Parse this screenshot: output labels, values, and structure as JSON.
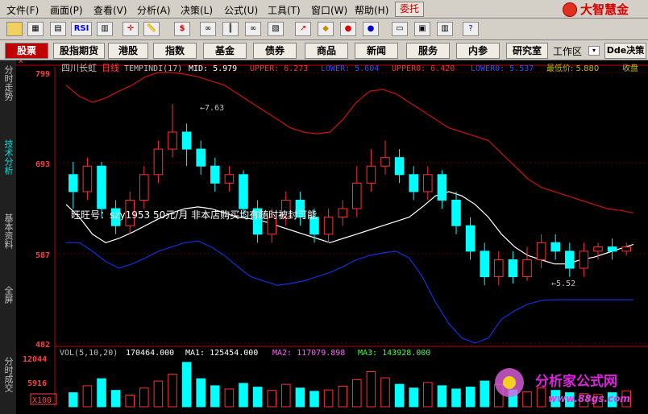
{
  "menu": [
    "文件(F)",
    "画面(P)",
    "查看(V)",
    "分析(A)",
    "决策(L)",
    "公式(U)",
    "工具(T)",
    "窗口(W)",
    "帮助(H)"
  ],
  "delegate_label": "委托",
  "brand": "大智慧金",
  "tabs": [
    "股票",
    "股指期货",
    "港股",
    "指数",
    "基金",
    "债券",
    "商品",
    "新闻",
    "服务",
    "内参",
    "研究室"
  ],
  "workspace_label": "工作区",
  "dde_label": "Dde决策",
  "side_tabs": [
    "分时走势",
    "技术分析",
    "基本资料",
    "全屏",
    "分时成交"
  ],
  "stock": {
    "name": "四川长虹",
    "period": "日线"
  },
  "indicator_line": {
    "name": "TEMPINDI(17)",
    "mid": "MID: 5.979",
    "upper": "UPPER: 6.273",
    "lower": "LOWER: 5.604",
    "upper0": "UPPER0: 6.420",
    "lower0": "LOWER0: 5.537",
    "min_price": "最低价: 5.880",
    "close": "收盘"
  },
  "y_labels": [
    "799",
    "693",
    "587",
    "482"
  ],
  "annotations": {
    "high": "7.63",
    "low": "5.52"
  },
  "ad_text": "旺旺号：szy1953 50元/月 非本店购买均有随时被封可能",
  "volume": {
    "title": "VOL(5,10,20)",
    "vol": "170464.000",
    "ma1": "MA1: 125454.000",
    "ma2": "MA2: 117079.898",
    "ma3": "MA3: 143928.000",
    "y_labels": [
      "12044",
      "5916"
    ],
    "unit": "X100"
  },
  "watermark": {
    "title": "分析家公式网",
    "url": "www.88gs.com"
  },
  "colors": {
    "up": "#ff3030",
    "down": "#00ffff",
    "mid": "#ffffff",
    "upper": "#d01010",
    "lower": "#1030e0",
    "axis": "#c00000"
  },
  "chart_data": {
    "type": "candlestick",
    "title": "四川长虹 日线",
    "ylim": [
      4.82,
      8.0
    ],
    "mid": [
      6.45,
      6.3,
      6.1,
      6.0,
      6.05,
      6.12,
      6.2,
      6.28,
      6.35,
      6.4,
      6.42,
      6.4,
      6.35,
      6.3,
      6.28,
      6.25,
      6.2,
      6.15,
      6.1,
      6.05,
      6.0,
      6.05,
      6.1,
      6.15,
      6.2,
      6.25,
      6.3,
      6.42,
      6.55,
      6.6,
      6.55,
      6.45,
      6.3,
      6.1,
      5.95,
      5.85,
      5.8,
      5.75,
      5.75,
      5.8,
      5.83,
      5.88,
      5.93,
      5.98
    ],
    "upper": [
      7.85,
      7.72,
      7.65,
      7.7,
      7.78,
      7.85,
      7.95,
      8.0,
      8.0,
      7.98,
      7.95,
      7.9,
      7.85,
      7.75,
      7.65,
      7.55,
      7.45,
      7.35,
      7.3,
      7.28,
      7.3,
      7.45,
      7.65,
      7.78,
      7.8,
      7.75,
      7.65,
      7.55,
      7.45,
      7.35,
      7.3,
      7.25,
      7.2,
      7.05,
      6.9,
      6.75,
      6.65,
      6.6,
      6.55,
      6.5,
      6.45,
      6.4,
      6.38,
      6.35
    ],
    "lower": [
      6.0,
      6.0,
      5.9,
      5.78,
      5.7,
      5.75,
      5.82,
      5.9,
      5.95,
      6.0,
      6.02,
      5.95,
      5.85,
      5.72,
      5.6,
      5.55,
      5.5,
      5.52,
      5.55,
      5.6,
      5.65,
      5.72,
      5.8,
      5.85,
      5.88,
      5.9,
      5.82,
      5.6,
      5.3,
      5.05,
      4.88,
      4.82,
      4.88,
      5.1,
      5.2,
      5.28,
      5.32,
      5.33,
      5.33,
      5.33,
      5.33,
      5.33,
      5.33,
      5.33
    ],
    "candles": [
      [
        6.8,
        6.6,
        6.95,
        6.4
      ],
      [
        6.6,
        6.9,
        7.0,
        6.5
      ],
      [
        6.9,
        6.4,
        6.95,
        6.3
      ],
      [
        6.4,
        6.2,
        6.5,
        6.1
      ],
      [
        6.2,
        6.5,
        6.6,
        6.1
      ],
      [
        6.5,
        6.8,
        6.9,
        6.4
      ],
      [
        6.8,
        7.1,
        7.2,
        6.7
      ],
      [
        7.1,
        7.3,
        7.63,
        7.0
      ],
      [
        7.3,
        7.1,
        7.4,
        6.9
      ],
      [
        7.1,
        6.9,
        7.2,
        6.8
      ],
      [
        6.9,
        6.7,
        7.0,
        6.6
      ],
      [
        6.7,
        6.8,
        6.9,
        6.6
      ],
      [
        6.8,
        6.4,
        6.85,
        6.3
      ],
      [
        6.4,
        6.1,
        6.5,
        6.0
      ],
      [
        6.1,
        6.3,
        6.4,
        6.0
      ],
      [
        6.3,
        6.5,
        6.6,
        6.2
      ],
      [
        6.5,
        6.3,
        6.6,
        6.2
      ],
      [
        6.3,
        6.1,
        6.4,
        6.0
      ],
      [
        6.1,
        6.3,
        6.4,
        6.0
      ],
      [
        6.3,
        6.4,
        6.5,
        6.2
      ],
      [
        6.4,
        6.7,
        6.9,
        6.3
      ],
      [
        6.7,
        6.9,
        7.1,
        6.6
      ],
      [
        6.9,
        7.0,
        7.2,
        6.8
      ],
      [
        7.0,
        6.8,
        7.1,
        6.7
      ],
      [
        6.8,
        6.6,
        6.9,
        6.5
      ],
      [
        6.6,
        6.8,
        6.9,
        6.5
      ],
      [
        6.8,
        6.5,
        6.85,
        6.4
      ],
      [
        6.5,
        6.2,
        6.6,
        6.1
      ],
      [
        6.2,
        5.9,
        6.3,
        5.8
      ],
      [
        5.9,
        5.6,
        6.0,
        5.5
      ],
      [
        5.6,
        5.8,
        5.9,
        5.5
      ],
      [
        5.8,
        5.6,
        5.9,
        5.52
      ],
      [
        5.6,
        5.8,
        5.95,
        5.55
      ],
      [
        5.8,
        6.0,
        6.1,
        5.7
      ],
      [
        6.0,
        5.9,
        6.1,
        5.8
      ],
      [
        5.9,
        5.7,
        6.0,
        5.6
      ],
      [
        5.7,
        5.9,
        6.0,
        5.6
      ],
      [
        5.9,
        5.95,
        6.0,
        5.8
      ],
      [
        5.95,
        5.9,
        6.05,
        5.8
      ],
      [
        5.9,
        5.95,
        6.0,
        5.85
      ]
    ],
    "volumes": [
      30,
      45,
      60,
      35,
      25,
      40,
      55,
      70,
      95,
      60,
      45,
      38,
      50,
      42,
      35,
      48,
      40,
      33,
      36,
      44,
      58,
      75,
      62,
      48,
      40,
      52,
      45,
      38,
      42,
      55,
      48,
      36,
      32,
      40,
      35,
      30,
      28,
      26,
      30,
      34
    ]
  }
}
